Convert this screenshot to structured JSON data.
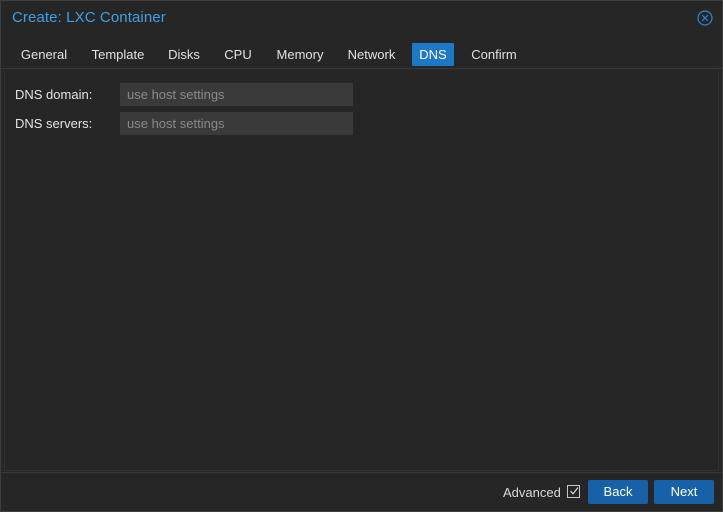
{
  "window": {
    "title": "Create: LXC Container",
    "close_icon": "close-circle-icon"
  },
  "tabs": [
    {
      "label": "General",
      "active": false
    },
    {
      "label": "Template",
      "active": false
    },
    {
      "label": "Disks",
      "active": false
    },
    {
      "label": "CPU",
      "active": false
    },
    {
      "label": "Memory",
      "active": false
    },
    {
      "label": "Network",
      "active": false
    },
    {
      "label": "DNS",
      "active": true
    },
    {
      "label": "Confirm",
      "active": false
    }
  ],
  "form": {
    "dns_domain": {
      "label": "DNS domain:",
      "value": "",
      "placeholder": "use host settings"
    },
    "dns_servers": {
      "label": "DNS servers:",
      "value": "",
      "placeholder": "use host settings"
    }
  },
  "footer": {
    "advanced_label": "Advanced",
    "advanced_checked": true,
    "back_label": "Back",
    "next_label": "Next"
  },
  "colors": {
    "accent": "#1d78c8",
    "button": "#1761a8",
    "title": "#3ea0e6",
    "background": "#262626"
  }
}
